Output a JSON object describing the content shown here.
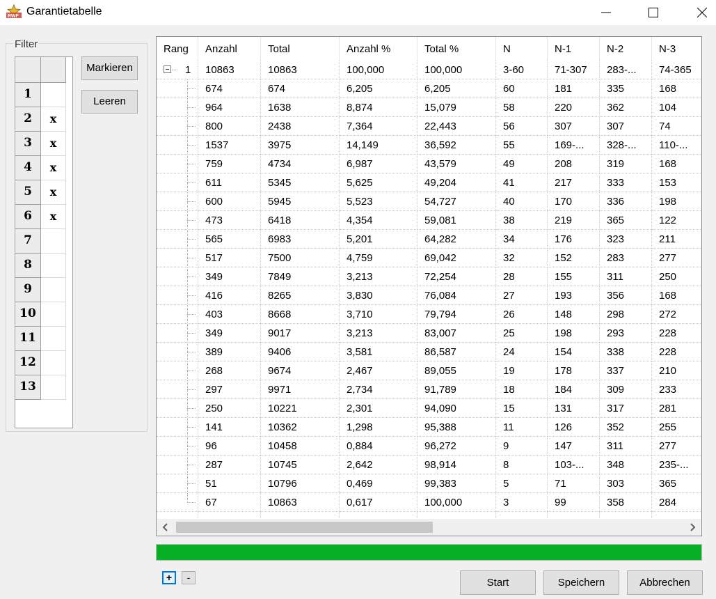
{
  "window": {
    "title": "Garantietabelle"
  },
  "filter": {
    "legend": "Filter",
    "rows": [
      {
        "num": "1",
        "mark": ""
      },
      {
        "num": "2",
        "mark": "x"
      },
      {
        "num": "3",
        "mark": "x"
      },
      {
        "num": "4",
        "mark": "x"
      },
      {
        "num": "5",
        "mark": "x"
      },
      {
        "num": "6",
        "mark": "x"
      },
      {
        "num": "7",
        "mark": ""
      },
      {
        "num": "8",
        "mark": ""
      },
      {
        "num": "9",
        "mark": ""
      },
      {
        "num": "10",
        "mark": ""
      },
      {
        "num": "11",
        "mark": ""
      },
      {
        "num": "12",
        "mark": ""
      },
      {
        "num": "13",
        "mark": ""
      }
    ],
    "mark_button": "Markieren",
    "clear_button": "Leeren"
  },
  "table": {
    "columns": [
      "Rang",
      "Anzahl",
      "Total",
      "Anzahl %",
      "Total %",
      "N",
      "N-1",
      "N-2",
      "N-3"
    ],
    "root": {
      "rang": "1",
      "cells": [
        "10863",
        "10863",
        "100,000",
        "100,000",
        "3-60",
        "71-307",
        "283-...",
        "74-365"
      ]
    },
    "rows": [
      [
        "674",
        "674",
        "6,205",
        "6,205",
        "60",
        "181",
        "335",
        "168"
      ],
      [
        "964",
        "1638",
        "8,874",
        "15,079",
        "58",
        "220",
        "362",
        "104"
      ],
      [
        "800",
        "2438",
        "7,364",
        "22,443",
        "56",
        "307",
        "307",
        "74"
      ],
      [
        "1537",
        "3975",
        "14,149",
        "36,592",
        "55",
        "169-...",
        "328-...",
        "110-..."
      ],
      [
        "759",
        "4734",
        "6,987",
        "43,579",
        "49",
        "208",
        "319",
        "168"
      ],
      [
        "611",
        "5345",
        "5,625",
        "49,204",
        "41",
        "217",
        "333",
        "153"
      ],
      [
        "600",
        "5945",
        "5,523",
        "54,727",
        "40",
        "170",
        "336",
        "198"
      ],
      [
        "473",
        "6418",
        "4,354",
        "59,081",
        "38",
        "219",
        "365",
        "122"
      ],
      [
        "565",
        "6983",
        "5,201",
        "64,282",
        "34",
        "176",
        "323",
        "211"
      ],
      [
        "517",
        "7500",
        "4,759",
        "69,042",
        "32",
        "152",
        "283",
        "277"
      ],
      [
        "349",
        "7849",
        "3,213",
        "72,254",
        "28",
        "155",
        "311",
        "250"
      ],
      [
        "416",
        "8265",
        "3,830",
        "76,084",
        "27",
        "193",
        "356",
        "168"
      ],
      [
        "403",
        "8668",
        "3,710",
        "79,794",
        "26",
        "148",
        "298",
        "272"
      ],
      [
        "349",
        "9017",
        "3,213",
        "83,007",
        "25",
        "198",
        "293",
        "228"
      ],
      [
        "389",
        "9406",
        "3,581",
        "86,587",
        "24",
        "154",
        "338",
        "228"
      ],
      [
        "268",
        "9674",
        "2,467",
        "89,055",
        "19",
        "178",
        "337",
        "210"
      ],
      [
        "297",
        "9971",
        "2,734",
        "91,789",
        "18",
        "184",
        "309",
        "233"
      ],
      [
        "250",
        "10221",
        "2,301",
        "94,090",
        "15",
        "131",
        "317",
        "281"
      ],
      [
        "141",
        "10362",
        "1,298",
        "95,388",
        "11",
        "126",
        "352",
        "255"
      ],
      [
        "96",
        "10458",
        "0,884",
        "96,272",
        "9",
        "147",
        "311",
        "277"
      ],
      [
        "287",
        "10745",
        "2,642",
        "98,914",
        "8",
        "103-...",
        "348",
        "235-..."
      ],
      [
        "51",
        "10796",
        "0,469",
        "99,383",
        "5",
        "71",
        "303",
        "365"
      ],
      [
        "67",
        "10863",
        "0,617",
        "100,000",
        "3",
        "99",
        "358",
        "284"
      ]
    ]
  },
  "progress": {
    "fraction": 1.0,
    "color": "#06b025"
  },
  "tree_buttons": {
    "expand": "+",
    "collapse": "-"
  },
  "buttons": {
    "start": "Start",
    "save": "Speichern",
    "cancel": "Abbrechen"
  },
  "icons": [
    "app-icon",
    "minimize-icon",
    "maximize-icon",
    "close-icon",
    "collapse-node-icon",
    "scroll-left-icon",
    "scroll-right-icon"
  ]
}
